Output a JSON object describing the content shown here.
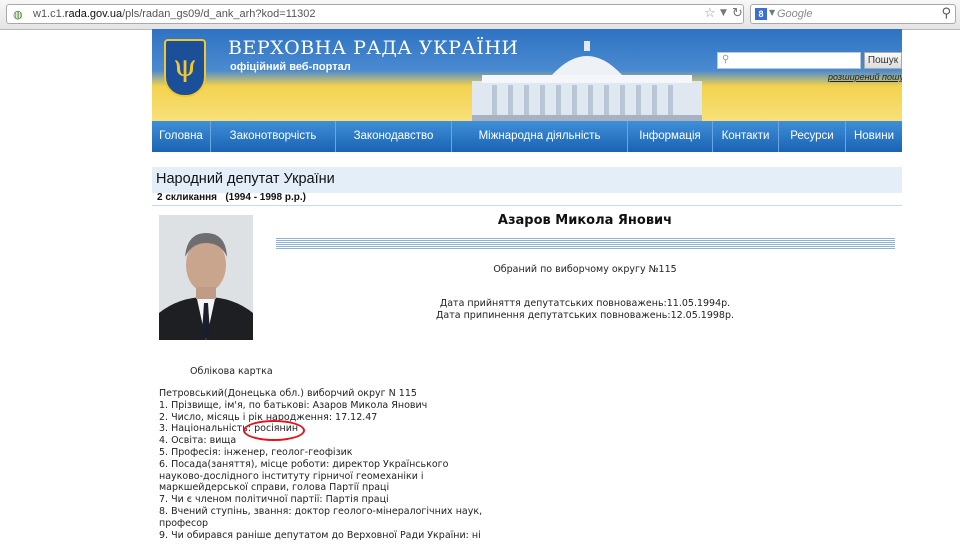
{
  "browser": {
    "url_prefix": "w1.c1.",
    "url_domain": "rada.gov.ua",
    "url_path": "/pls/radan_gs09/d_ank_arh?kod=11302",
    "search_engine_placeholder": "Google"
  },
  "header": {
    "title": "ВЕРХОВНА РАДА УКРАЇНИ",
    "subtitle": "офіційний веб-портал",
    "search_button": "Пошук",
    "advanced_search": "розширений пошук",
    "crest_glyph": "ψ"
  },
  "nav": [
    "Головна",
    "Законотворчість",
    "Законодавство",
    "Міжнародна діяльність",
    "Інформація",
    "Контакти",
    "Ресурси",
    "Новини"
  ],
  "page": {
    "title": "Народний депутат України",
    "convocation": "2 скликання   (1994 - 1998 р.р.)",
    "deputy_name": "Азаров Микола Янович",
    "district": "Обраний по виборчому округу №115",
    "start_date": "Дата прийняття депутатських повноважень:11.05.1994р.",
    "end_date": "Дата припинення депутатських повноважень:12.05.1998р.",
    "card_label": "Облікова картка"
  },
  "card": {
    "lines": [
      "Петровський(Донецька обл.) виборчий округ N 115",
      " 1. Прізвище, ім'я, по батькові: Азаров Микола Янович",
      " 2. Число, місяць і рік народження: 17.12.47",
      " 3. Національність: росіянин",
      " 4. Освіта: вища",
      " 5. Професія: інженер, геолог-геофізик",
      " 6. Посада(заняття), місце роботи: директор Українського",
      " науково-дослідного інституту гірничої геомеханіки і",
      " маркшейдерської справи, голова Партії праці",
      " 7. Чи є членом політичної партії: Партія праці",
      " 8. Вчений ступінь, звання: доктор геолого-мінералогічних наук,",
      " професор",
      " 9. Чи обирався раніше депутатом до Верховної Ради України: ні"
    ]
  },
  "colors": {
    "nav": "#1a63b3",
    "highlight": "#e0141c"
  }
}
